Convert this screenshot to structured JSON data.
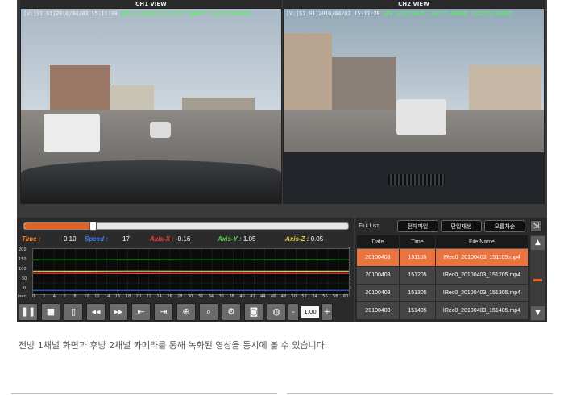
{
  "viewer": {
    "ch1": {
      "title": "CH1 VIEW",
      "osd_prefix": "[V:]S1.01]2010/04/03 15:11:30",
      "osd_gps": "GPS",
      "osd_rest": "S:017km/h la3717.08087 lo12713.06548"
    },
    "ch2": {
      "title": "CH2 VIEW",
      "osd_prefix": "[V:]S1.01]2010/04/03 15:11:28",
      "osd_gps": "GPS",
      "osd_rest": "S:017km/h la3717.09009 lo12713.00055"
    }
  },
  "playback": {
    "progress_fraction": 0.21
  },
  "readouts": {
    "time_label": "Time :",
    "time_value": "0:10",
    "speed_label": "Speed :",
    "speed_value": "17",
    "x_label": "Axis-X :",
    "x_value": "-0.16",
    "y_label": "Axis-Y :",
    "y_value": "1.05",
    "z_label": "Axis-Z :",
    "z_value": "0.05"
  },
  "graph": {
    "left_ticks": [
      "200",
      "150",
      "100",
      "50",
      "0"
    ],
    "right_ticks": [
      "2",
      "1",
      "0",
      "-1",
      "-2"
    ],
    "x_unit": "(sec)",
    "x_ticks": [
      "0",
      "2",
      "4",
      "6",
      "8",
      "10",
      "12",
      "14",
      "16",
      "18",
      "20",
      "22",
      "24",
      "26",
      "28",
      "30",
      "32",
      "34",
      "36",
      "38",
      "40",
      "42",
      "44",
      "46",
      "48",
      "50",
      "52",
      "54",
      "56",
      "58",
      "60"
    ]
  },
  "chart_data": {
    "type": "line",
    "title": "",
    "xlabel": "(sec)",
    "ylabel": "",
    "xlim": [
      0,
      60
    ],
    "ylim": [
      0,
      200
    ],
    "y2lim": [
      -2,
      2
    ],
    "grid": true,
    "series": [
      {
        "name": "Speed",
        "color": "#2f6bff",
        "axis": "left",
        "x": [
          0,
          10,
          20,
          30,
          40,
          50,
          60
        ],
        "values": [
          17,
          17,
          17,
          17,
          17,
          17,
          17
        ]
      },
      {
        "name": "Axis-X",
        "color": "#ff3b3b",
        "axis": "right",
        "x": [
          0,
          10,
          20,
          30,
          40,
          50,
          60
        ],
        "values": [
          -0.16,
          -0.15,
          -0.17,
          -0.16,
          -0.15,
          -0.16,
          -0.16
        ]
      },
      {
        "name": "Axis-Y",
        "color": "#4bd64b",
        "axis": "right",
        "x": [
          0,
          10,
          20,
          30,
          40,
          50,
          60
        ],
        "values": [
          1.05,
          1.04,
          1.06,
          1.05,
          1.05,
          1.06,
          1.05
        ]
      },
      {
        "name": "Axis-Z",
        "color": "#e8d23a",
        "axis": "right",
        "x": [
          0,
          10,
          20,
          30,
          40,
          50,
          60
        ],
        "values": [
          0.05,
          0.04,
          0.06,
          0.05,
          0.05,
          0.04,
          0.05
        ]
      }
    ]
  },
  "toolbar": {
    "buttons": [
      "pause-icon",
      "stop-icon",
      "file-open-icon",
      "rewind-icon",
      "forward-icon",
      "prev-frame-icon",
      "next-frame-icon",
      "zoom-in-icon",
      "search-file-icon",
      "settings-gear-icon",
      "snapshot-camera-icon",
      "map-globe-icon"
    ],
    "glyphs": [
      "❚❚",
      "■",
      "▯",
      "◂◂",
      "▸▸",
      "⇤",
      "⇥",
      "⊕",
      "⌕",
      "⚙",
      "◙",
      "◍"
    ],
    "zoom_minus": "-",
    "zoom_value": "1.00",
    "zoom_plus": "+"
  },
  "filelist": {
    "title": "File List",
    "buttons": [
      "전체파일",
      "단일재생",
      "오름차순"
    ],
    "close": "⇲",
    "headers": [
      "Date",
      "Time",
      "File Name"
    ],
    "rows": [
      {
        "date": "20100403",
        "time": "151105",
        "file": "IRec0_20100403_151105.mp4"
      },
      {
        "date": "20100403",
        "time": "151205",
        "file": "IRec0_20100403_151205.mp4"
      },
      {
        "date": "20100403",
        "time": "151305",
        "file": "IRec0_20100403_151305.mp4"
      },
      {
        "date": "20100403",
        "time": "151405",
        "file": "IRec0_20100403_151405.mp4"
      }
    ],
    "selected_index": 0
  },
  "colors": {
    "accent": "#e8601c",
    "selected_row": "#e9743f"
  },
  "caption": "전방 1채널 화면과 후방 2채널 카메라를 통해 녹화된 영상을 동시에 볼 수 있습니다."
}
